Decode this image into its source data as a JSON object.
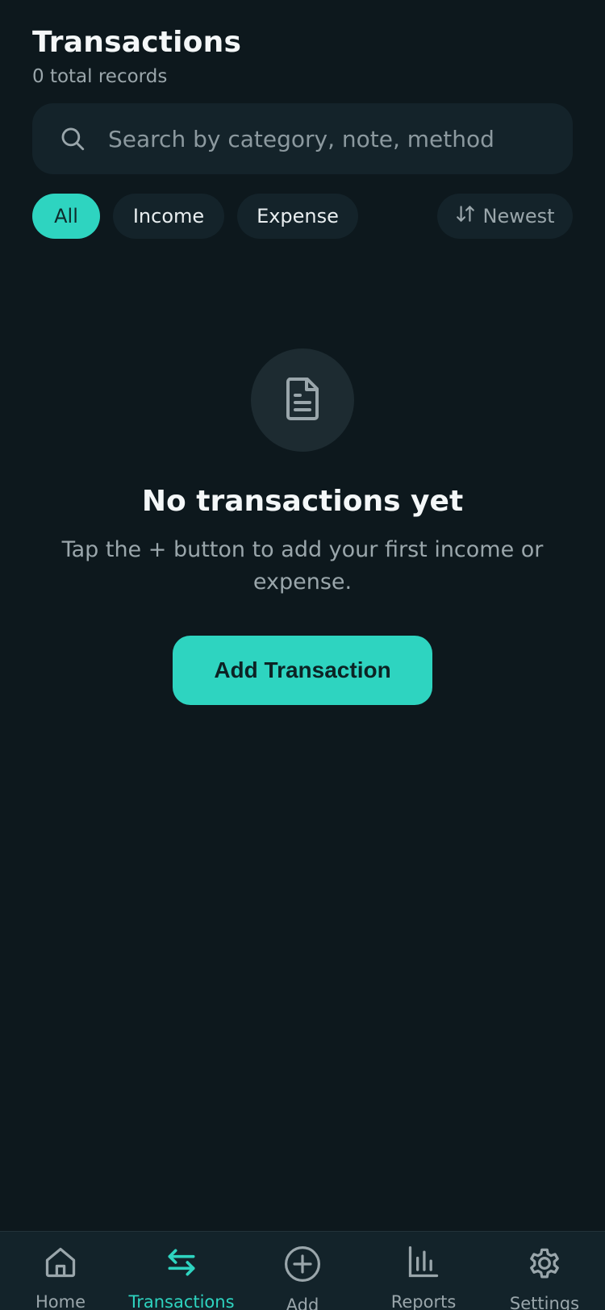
{
  "header": {
    "title": "Transactions",
    "subtitle": "0 total records"
  },
  "search": {
    "placeholder": "Search by category, note, method",
    "value": ""
  },
  "filters": {
    "chips": [
      "All",
      "Income",
      "Expense"
    ],
    "selected": "All",
    "sort_label": "Newest"
  },
  "empty_state": {
    "title": "No transactions yet",
    "message": "Tap the + button to add your first income or expense.",
    "button_label": "Add Transaction"
  },
  "bottom_nav": {
    "items": [
      {
        "label": "Home",
        "icon": "home-icon"
      },
      {
        "label": "Transactions",
        "icon": "transfer-arrows-icon"
      },
      {
        "label": "Add",
        "icon": "plus-circle-icon"
      },
      {
        "label": "Reports",
        "icon": "bar-chart-icon"
      },
      {
        "label": "Settings",
        "icon": "gear-icon"
      }
    ],
    "active": "Transactions"
  },
  "colors": {
    "background": "#0d181d",
    "surface": "#14232a",
    "accent": "#2ed4c0",
    "muted_text": "#9aa6ab"
  }
}
